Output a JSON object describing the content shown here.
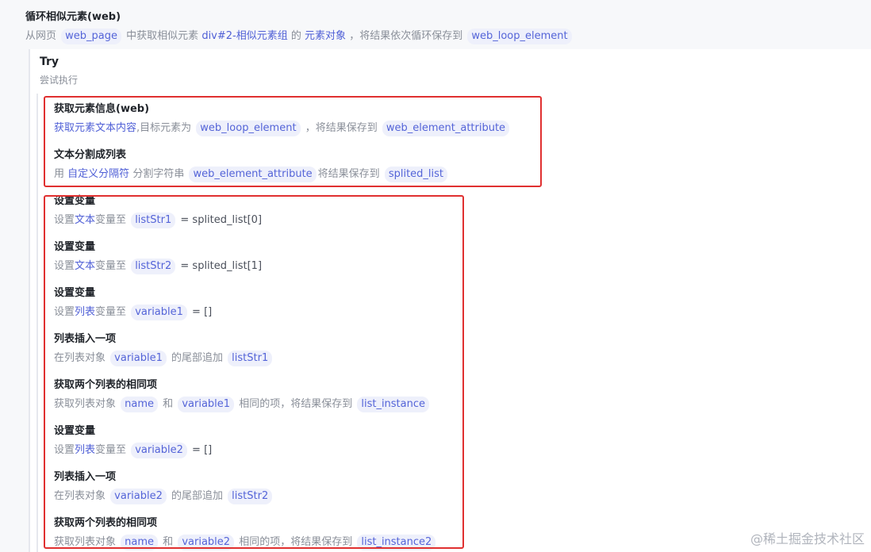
{
  "loop": {
    "title": "循环相似元素(web)",
    "desc": {
      "t1": "从网页",
      "p1": "web_page",
      "t2": "中获取相似元素",
      "k1": "div#2-相似元素组",
      "t3": "的",
      "k2": "元素对象",
      "t4": "，将结果依次循环保存到",
      "p2": "web_loop_element"
    }
  },
  "try": {
    "title": "Try",
    "subtitle": "尝试执行"
  },
  "steps": [
    {
      "title": "获取元素信息(web)",
      "desc": {
        "k1": "获取元素文本内容",
        "t1": ",目标元素为",
        "p1": "web_loop_element",
        "t2": "，将结果保存到",
        "p2": "web_element_attribute"
      }
    },
    {
      "title": "文本分割成列表",
      "desc": {
        "t1": "用",
        "k1": "自定义分隔符",
        "t2": "分割字符串",
        "p1": "web_element_attribute",
        "t3": "将结果保存到",
        "p2": "splited_list"
      }
    },
    {
      "title": "设置变量",
      "desc": {
        "t1": "设置",
        "k1": "文本",
        "t2": "变量至",
        "p1": "listStr1",
        "v1": "= splited_list[0]"
      }
    },
    {
      "title": "设置变量",
      "desc": {
        "t1": "设置",
        "k1": "文本",
        "t2": "变量至",
        "p1": "listStr2",
        "v1": "= splited_list[1]"
      }
    },
    {
      "title": "设置变量",
      "desc": {
        "t1": "设置",
        "k1": "列表",
        "t2": "变量至",
        "p1": "variable1",
        "v1": "= []"
      }
    },
    {
      "title": "列表插入一项",
      "desc": {
        "t1": "在列表对象",
        "p1": "variable1",
        "t2": "的尾部追加",
        "p2": "listStr1"
      }
    },
    {
      "title": "获取两个列表的相同项",
      "desc": {
        "t1": "获取列表对象",
        "p1": "name",
        "t2": "和",
        "p2": "variable1",
        "t3": "相同的项，将结果保存到",
        "p3": "list_instance"
      }
    },
    {
      "title": "设置变量",
      "desc": {
        "t1": "设置",
        "k1": "列表",
        "t2": "变量至",
        "p1": "variable2",
        "v1": "= []"
      }
    },
    {
      "title": "列表插入一项",
      "desc": {
        "t1": "在列表对象",
        "p1": "variable2",
        "t2": "的尾部追加",
        "p2": "listStr2"
      }
    },
    {
      "title": "获取两个列表的相同项",
      "desc": {
        "t1": "获取列表对象",
        "p1": "name",
        "t2": "和",
        "p2": "variable2",
        "t3": "相同的项，将结果保存到",
        "p3": "list_instance2"
      }
    }
  ],
  "watermark": "@稀土掘金技术社区",
  "colors": {
    "highlight_box": "#e03030",
    "keyword": "#4f5fd6",
    "pill_bg": "#eef0fb"
  }
}
